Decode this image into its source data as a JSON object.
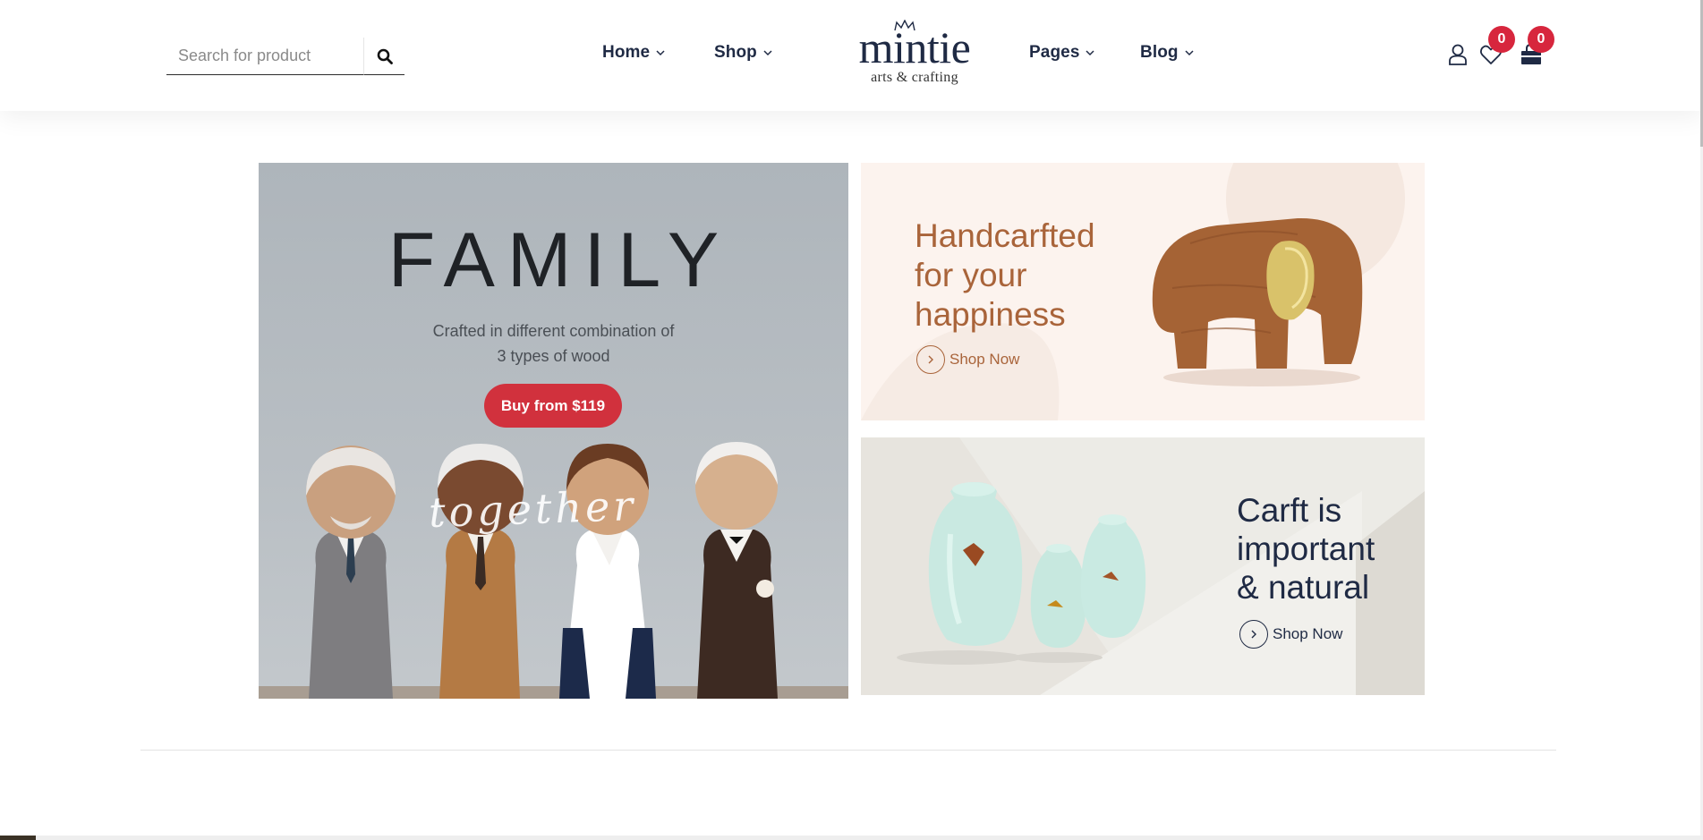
{
  "search": {
    "placeholder": "Search for product"
  },
  "nav": {
    "left": [
      {
        "label": "Home"
      },
      {
        "label": "Shop"
      }
    ],
    "right": [
      {
        "label": "Pages"
      },
      {
        "label": "Blog"
      }
    ]
  },
  "logo": {
    "name": "mintie",
    "tagline": "arts & crafting"
  },
  "header_icons": {
    "wishlist_count": "0",
    "cart_count": "0"
  },
  "colors": {
    "accent": "#d1313d",
    "navy": "#1f2a44",
    "copper": "#a9643a",
    "badge": "#d7263d"
  },
  "banners": {
    "family": {
      "title": "FAMILY",
      "subtitle_line1": "Crafted in different combination of",
      "subtitle_line2": "3 types of wood",
      "button": "Buy from $119",
      "script": "together"
    },
    "handcrafted": {
      "title_line1": "Handcarfted",
      "title_line2": "for your",
      "title_line3": "happiness",
      "link": "Shop Now"
    },
    "craft": {
      "title_line1": "Carft is",
      "title_line2": "important",
      "title_line3": "& natural",
      "link": "Shop Now"
    }
  }
}
